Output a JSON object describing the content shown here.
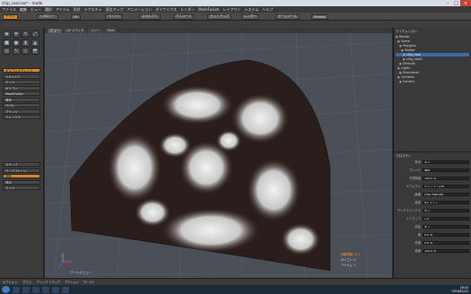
{
  "window": {
    "title": "chip_rose.lxo* - modo"
  },
  "menu": [
    "ファイル",
    "編集",
    "ビュー",
    "選択",
    "アイテム",
    "形状",
    "テクスチャ",
    "頂点マップ",
    "アニメーション",
    "ダイナミクス",
    "レンダー",
    "MeshFusion",
    "レイアウト",
    "システム",
    "ヘルプ"
  ],
  "toolbar": {
    "items": [
      "モデル",
      "トポロジー",
      "UV",
      "ペイント",
      "スカルプト",
      "アニメート",
      "セットアップ",
      "レンダー",
      "ゲームツール",
      "Presets"
    ]
  },
  "viewport": {
    "tabs": [
      "ビュー",
      "UV エディタ",
      "ツリー",
      "Pixel"
    ],
    "corner_label": "ワールドビュー",
    "info": [
      "自動同期: オフ",
      "ポリゴン: 1",
      "アイテム: 1"
    ]
  },
  "left": {
    "rows": [
      "ポリゴンエディット",
      "ジオメトリ",
      "エッジ",
      "ポリゴン",
      "MeshFusion",
      "選択",
      "ベベル",
      "ブリッジ",
      "フレックス"
    ],
    "bottom": [
      "スナップ",
      "ワークプレーン",
      "自動",
      "頂点",
      "エッジ"
    ]
  },
  "items": {
    "header": "アイテムリスト",
    "list": [
      "Render",
      "Scene",
      "Polygons",
      "Shader",
      "chip_rose",
      "chip_rose2",
      "Defaults",
      "Lights",
      "Directional",
      "Cameras",
      "Camera"
    ]
  },
  "properties": {
    "header": "プロパティ",
    "rows": [
      {
        "label": "有効",
        "value": "オン"
      },
      {
        "label": "ブレンド",
        "value": "通常"
      },
      {
        "label": "不透明度",
        "value": "100.0 %"
      },
      {
        "label": "エフェクト",
        "value": "ディフューズ色"
      },
      {
        "label": "画像",
        "value": "chip_rose.jpg"
      },
      {
        "label": "投影",
        "value": "UV マップ"
      },
      {
        "label": "アンチエイリアス",
        "value": "オン"
      },
      {
        "label": "ミニマップ",
        "value": "1.0"
      },
      {
        "label": "反転",
        "value": "オフ"
      },
      {
        "label": "値",
        "value": "0.0 %"
      },
      {
        "label": "低値",
        "value": "0.0 %"
      },
      {
        "label": "高値",
        "value": "100.0 %"
      }
    ]
  },
  "status": [
    "オプション:",
    "マウス:",
    "クリック ドラッグ",
    "アクション",
    "ホールド"
  ],
  "clock": {
    "time": "18:03",
    "date": "2018/01/12"
  }
}
